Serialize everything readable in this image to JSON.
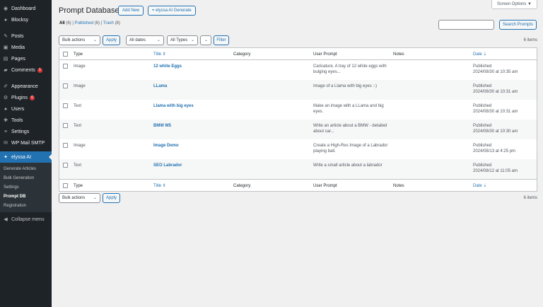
{
  "sidebar": {
    "items": [
      {
        "label": "Dashboard",
        "icon": "dashboard-icon",
        "glyph": "◉"
      },
      {
        "label": "Blocksy",
        "icon": "blocksy-icon",
        "glyph": "●"
      },
      {
        "label": "Posts",
        "icon": "pin-icon",
        "glyph": "✎"
      },
      {
        "label": "Media",
        "icon": "media-icon",
        "glyph": "▣"
      },
      {
        "label": "Pages",
        "icon": "pages-icon",
        "glyph": "▤"
      },
      {
        "label": "Comments",
        "icon": "comments-icon",
        "glyph": "▰",
        "badge": "1"
      },
      {
        "label": "Appearance",
        "icon": "brush-icon",
        "glyph": "✐"
      },
      {
        "label": "Plugins",
        "icon": "plugins-icon",
        "glyph": "⚙",
        "badge": "6"
      },
      {
        "label": "Users",
        "icon": "users-icon",
        "glyph": "●"
      },
      {
        "label": "Tools",
        "icon": "tools-icon",
        "glyph": "✚"
      },
      {
        "label": "Settings",
        "icon": "settings-icon",
        "glyph": "≡"
      },
      {
        "label": "WP Mail SMTP",
        "icon": "mail-icon",
        "glyph": "✉"
      },
      {
        "label": "elyssa AI",
        "icon": "sparkle-icon",
        "glyph": "✦"
      }
    ],
    "submenu": [
      "Generate Articles",
      "Bulk Generation",
      "Settings",
      "Prompt DB",
      "Registration"
    ],
    "collapse": "Collapse menu"
  },
  "header": {
    "screen_options": "Screen Options ▼",
    "title": "Prompt Database",
    "add_new": "Add New",
    "generate": "elyssa AI Generate"
  },
  "views": {
    "all": "All",
    "all_count": "(6)",
    "published": "Published",
    "published_count": "(6)",
    "trash": "Trash",
    "trash_count": "(8)",
    "sep": "|"
  },
  "search": {
    "button": "Search Prompts"
  },
  "filters": {
    "bulk_actions": "Bulk actions",
    "apply": "Apply",
    "dates": "All dates",
    "types": "All Types",
    "filter": "Filter",
    "items_count": "6 items"
  },
  "table": {
    "headers": {
      "type": "Type",
      "title": "Title ⇕",
      "category": "Category",
      "prompt": "User Prompt",
      "notes": "Notes",
      "date": "Date ⇣"
    },
    "rows": [
      {
        "type": "Image",
        "title": "12 white Eggs",
        "category": "",
        "prompt": "Caricature. A tray of 12 white eggs with bulging eyes...",
        "notes": "",
        "status": "Published",
        "date": "2024/08/30 at 10:35 am"
      },
      {
        "type": "Image",
        "title": "LLama",
        "category": "",
        "prompt": "Image of a Llama with big eyes :-)",
        "notes": "",
        "status": "Published",
        "date": "2024/08/30 at 10:31 am"
      },
      {
        "type": "Text",
        "title": "Llama with big eyes",
        "category": "",
        "prompt": "Make an image with a LLama and big eyes.",
        "notes": "",
        "status": "Published",
        "date": "2024/08/30 at 10:31 am"
      },
      {
        "type": "Text",
        "title": "BMW M5",
        "category": "",
        "prompt": "Write an article about a BMW - detailed about car...",
        "notes": "",
        "status": "Published",
        "date": "2024/08/30 at 10:30 am"
      },
      {
        "type": "Image",
        "title": "Image Demo",
        "category": "",
        "prompt": "Create a High-Res Image of a Labrador playing ball.",
        "notes": "",
        "status": "Published",
        "date": "2024/08/13 at 4:25 pm"
      },
      {
        "type": "Text",
        "title": "SEO Labrador",
        "category": "",
        "prompt": "Write a small article about a labrador",
        "notes": "",
        "status": "Published",
        "date": "2024/08/12 at 11:05 am"
      }
    ]
  },
  "colors": {
    "sidebar_bg": "#1d2327",
    "accent": "#2271b1",
    "badge": "#d63638"
  }
}
